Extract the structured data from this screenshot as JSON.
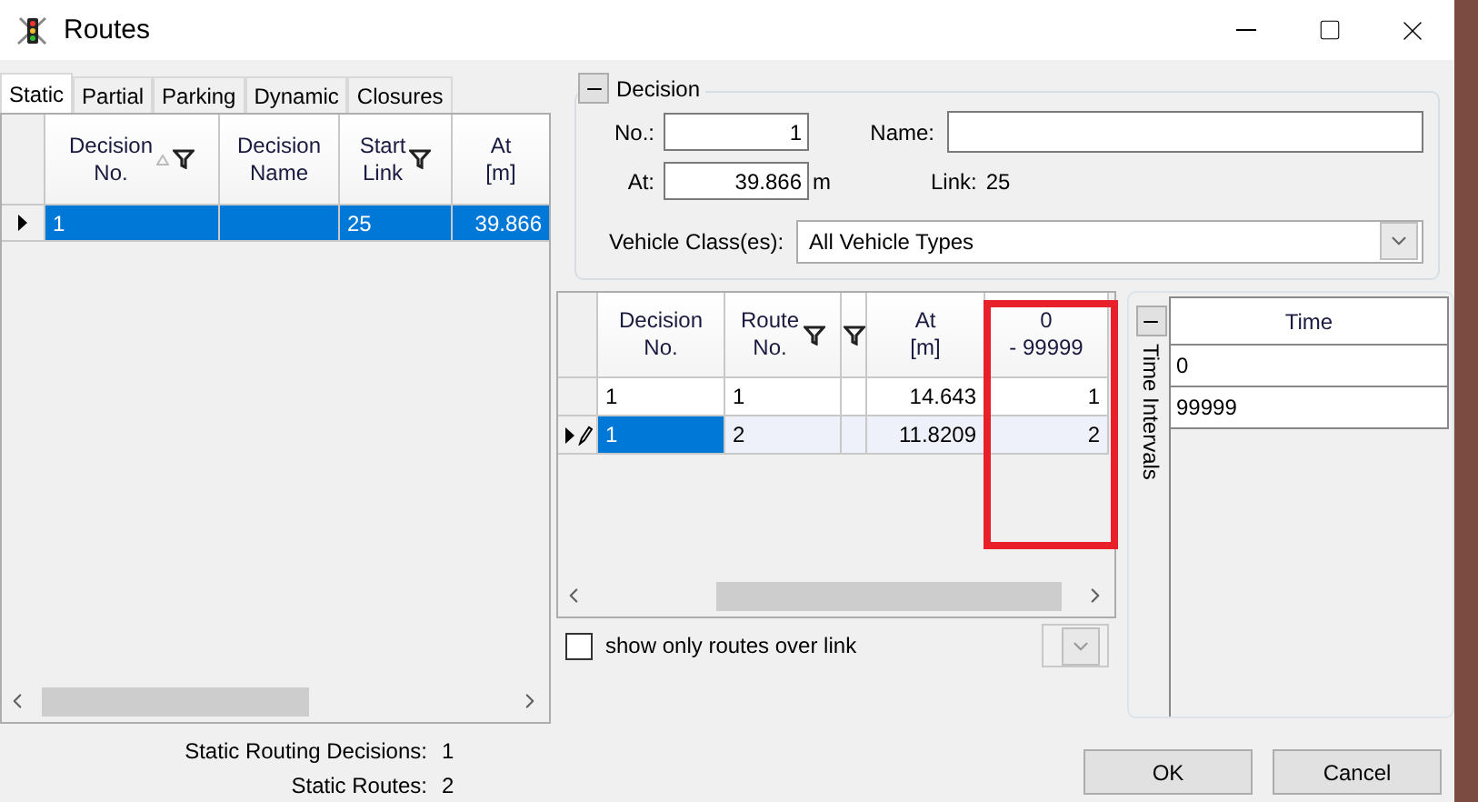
{
  "window": {
    "title": "Routes"
  },
  "tabs": [
    {
      "label": "Static",
      "selected": true
    },
    {
      "label": "Partial",
      "selected": false
    },
    {
      "label": "Parking",
      "selected": false
    },
    {
      "label": "Dynamic",
      "selected": false
    },
    {
      "label": "Closures",
      "selected": false
    }
  ],
  "decisions_table": {
    "columns": [
      {
        "label": "Decision\nNo.",
        "sorted": true,
        "filter": true
      },
      {
        "label": "Decision\nName",
        "sorted": false,
        "filter": false
      },
      {
        "label": "Start\nLink",
        "sorted": false,
        "filter": true
      },
      {
        "label": "At\n[m]",
        "sorted": false,
        "filter": false
      }
    ],
    "rows": [
      {
        "cells": [
          "1",
          "",
          "25",
          "39.866"
        ],
        "selected": true
      }
    ]
  },
  "decision": {
    "title": "Decision",
    "expanded": true,
    "no_label": "No.:",
    "no": "1",
    "name_label": "Name:",
    "at_label": "At:",
    "at": "39.866",
    "unit": "m",
    "link_label": "Link:",
    "link": "25",
    "vehicle_class_label": "Vehicle Class(es):",
    "vehicle_class": "All Vehicle Types"
  },
  "routes_table": {
    "columns": [
      {
        "label": "Decision\nNo.",
        "filter": false
      },
      {
        "label": "Route\nNo.",
        "filter": true
      },
      {
        "filter": true
      },
      {
        "label": "At\n[m]",
        "filter": false
      },
      {
        "label": "0\n- 99999",
        "filter": false
      }
    ],
    "rows": [
      {
        "cells": [
          "1",
          "1",
          "",
          "14.643",
          "1"
        ],
        "selected": false
      },
      {
        "cells": [
          "1",
          "2",
          "",
          "11.8209",
          "2"
        ],
        "selected": true
      }
    ]
  },
  "show_only_routes_over_link": {
    "label": "show only routes over link",
    "checked": false
  },
  "time_intervals": {
    "title": "Time Intervals",
    "expanded": true,
    "column": "Time",
    "rows": [
      "0",
      "99999"
    ]
  },
  "summary": [
    {
      "label": "Static Routing Decisions:",
      "value": "1"
    },
    {
      "label": "Static Routes:",
      "value": "2"
    }
  ],
  "buttons": [
    "OK",
    "Cancel"
  ]
}
